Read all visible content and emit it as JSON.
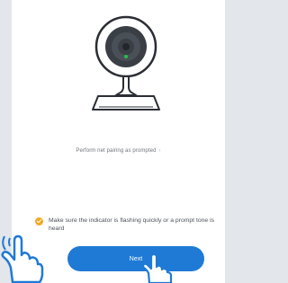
{
  "help_link": {
    "label": "Perform net pairing as prompted",
    "chevron": "chevron-right-icon"
  },
  "confirm": {
    "checked": true,
    "label": "Make sure the indicator is flashing quickly or a prompt tone is heard"
  },
  "next_button": {
    "label": "Next"
  },
  "colors": {
    "accent": "#1f7ad6",
    "check": "#f5a623",
    "led": "#22c24a"
  }
}
